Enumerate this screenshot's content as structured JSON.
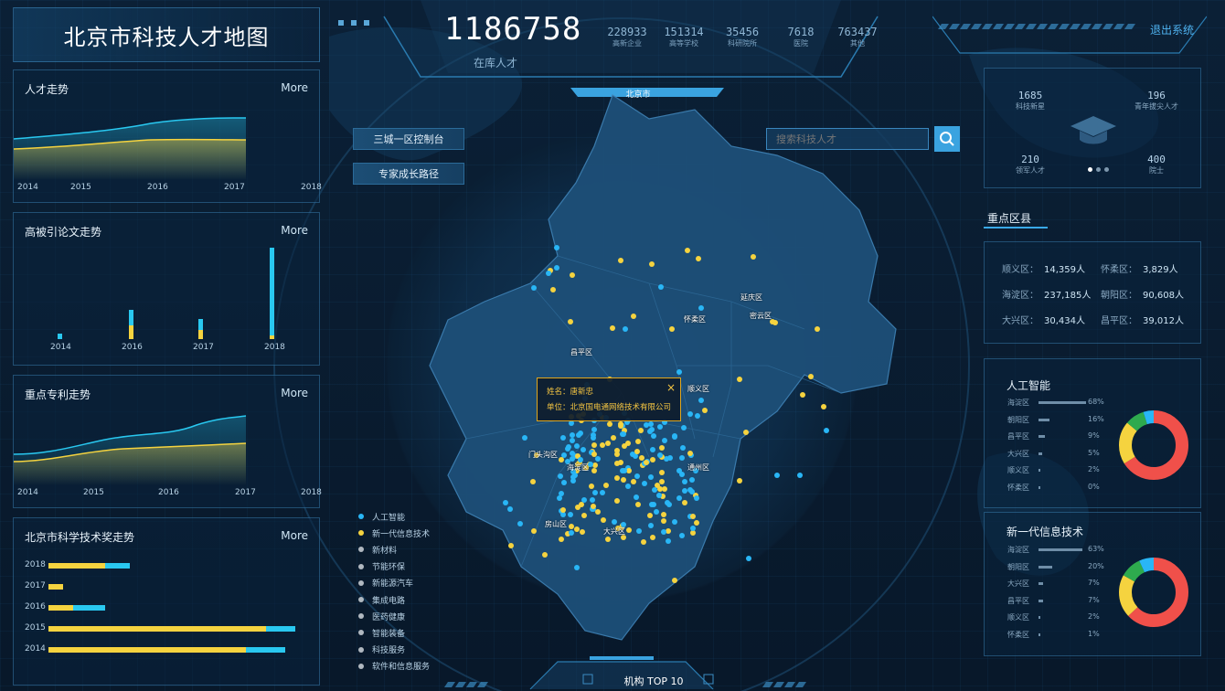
{
  "app_title": "北京市科技人才地图",
  "logout_label": "退出系统",
  "total": {
    "value": "1186758",
    "label": "在库人才"
  },
  "top_stats": [
    {
      "value": "228933",
      "label": "高新企业"
    },
    {
      "value": "151314",
      "label": "高等学校"
    },
    {
      "value": "35456",
      "label": "科研院所"
    },
    {
      "value": "7618",
      "label": "医院"
    },
    {
      "value": "763437",
      "label": "其他"
    }
  ],
  "map_region_label": "北京市",
  "buttons": {
    "control": "三城一区控制台",
    "path": "专家成长路径"
  },
  "search": {
    "placeholder": "搜索科技人才"
  },
  "tooltip": {
    "name": "姓名：唐新忠",
    "unit": "单位：北京国电通网络技术有限公司"
  },
  "map_districts": [
    "延庆区",
    "怀柔区",
    "密云区",
    "昌平区",
    "顺义区",
    "门头沟区",
    "海淀区",
    "通州区",
    "房山区",
    "大兴区"
  ],
  "legend": [
    {
      "label": "人工智能",
      "color": "#29b6f6"
    },
    {
      "label": "新一代信息技术",
      "color": "#f5d33f"
    },
    {
      "label": "新材料",
      "color": "#b0b8c0"
    },
    {
      "label": "节能环保",
      "color": "#b0b8c0"
    },
    {
      "label": "新能源汽车",
      "color": "#b0b8c0"
    },
    {
      "label": "集成电路",
      "color": "#b0b8c0"
    },
    {
      "label": "医药健康",
      "color": "#b0b8c0"
    },
    {
      "label": "智能装备",
      "color": "#b0b8c0"
    },
    {
      "label": "科技服务",
      "color": "#b0b8c0"
    },
    {
      "label": "软件和信息服务",
      "color": "#b0b8c0"
    }
  ],
  "bottom_tab": "机构 TOP 10",
  "panels": {
    "talent": {
      "title": "人才走势",
      "more": "More",
      "ticks": [
        "2014",
        "2015",
        "2016",
        "2017",
        "2018"
      ]
    },
    "papers": {
      "title": "高被引论文走势",
      "more": "More",
      "ticks": [
        "2014",
        "2016",
        "2017",
        "2018"
      ]
    },
    "patents": {
      "title": "重点专利走势",
      "more": "More",
      "ticks": [
        "2014",
        "2015",
        "2016",
        "2017",
        "2018"
      ]
    },
    "awards": {
      "title": "北京市科学技术奖走势",
      "more": "More",
      "years": [
        "2018",
        "2017",
        "2016",
        "2015",
        "2014"
      ]
    }
  },
  "awards_bars": [
    {
      "yellow": 0.23,
      "blue": 0.1
    },
    {
      "yellow": 0.06,
      "blue": 0.0
    },
    {
      "yellow": 0.1,
      "blue": 0.13
    },
    {
      "yellow": 0.88,
      "blue": 0.12
    },
    {
      "yellow": 0.8,
      "blue": 0.16
    }
  ],
  "paper_bars": [
    {
      "yellow": 0.0,
      "blue": 0.06
    },
    {
      "yellow": 0.15,
      "blue": 0.17
    },
    {
      "yellow": 0.1,
      "blue": 0.12
    },
    {
      "yellow": 0.04,
      "blue": 0.96
    }
  ],
  "right_stats": [
    {
      "value": "1685",
      "label": "科技新星"
    },
    {
      "value": "196",
      "label": "青年拔尖人才"
    },
    {
      "value": "210",
      "label": "领军人才"
    },
    {
      "value": "400",
      "label": "院士"
    }
  ],
  "key_districts_title": "重点区县",
  "key_districts": [
    {
      "name": "顺义区：",
      "value": "14,359人"
    },
    {
      "name": "怀柔区：",
      "value": "3,829人"
    },
    {
      "name": "海淀区：",
      "value": "237,185人"
    },
    {
      "name": "朝阳区：",
      "value": "90,608人"
    },
    {
      "name": "大兴区：",
      "value": "30,434人"
    },
    {
      "name": "昌平区：",
      "value": "39,012人"
    }
  ],
  "ai": {
    "title": "人工智能",
    "rows": [
      {
        "name": "海淀区",
        "pct": "68%",
        "frac": 0.68
      },
      {
        "name": "朝阳区",
        "pct": "16%",
        "frac": 0.16
      },
      {
        "name": "昌平区",
        "pct": "9%",
        "frac": 0.09
      },
      {
        "name": "大兴区",
        "pct": "5%",
        "frac": 0.05
      },
      {
        "name": "顺义区",
        "pct": "2%",
        "frac": 0.02
      },
      {
        "name": "怀柔区",
        "pct": "0%",
        "frac": 0.0
      }
    ]
  },
  "it": {
    "title": "新一代信息技术",
    "rows": [
      {
        "name": "海淀区",
        "pct": "63%",
        "frac": 0.63
      },
      {
        "name": "朝阳区",
        "pct": "20%",
        "frac": 0.2
      },
      {
        "name": "大兴区",
        "pct": "7%",
        "frac": 0.07
      },
      {
        "name": "昌平区",
        "pct": "7%",
        "frac": 0.07
      },
      {
        "name": "顺义区",
        "pct": "2%",
        "frac": 0.02
      },
      {
        "name": "怀柔区",
        "pct": "1%",
        "frac": 0.01
      }
    ]
  },
  "donut_colors": [
    "#f0504a",
    "#f5d33f",
    "#2eaa4e",
    "#29b6f6"
  ],
  "colors": {
    "accent": "#39a9e8",
    "yellow": "#f5d33f",
    "cyan": "#29c8f0"
  }
}
